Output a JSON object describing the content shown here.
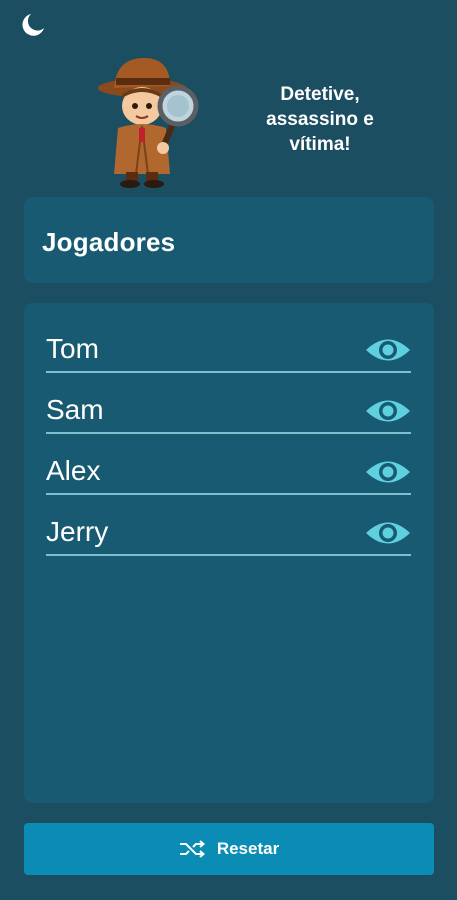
{
  "header": {
    "title": "Detetive,\nassassino e\nvítima!"
  },
  "players_card": {
    "title": "Jogadores"
  },
  "players": [
    {
      "name": "Tom"
    },
    {
      "name": "Sam"
    },
    {
      "name": "Alex"
    },
    {
      "name": "Jerry"
    }
  ],
  "footer": {
    "reset_label": "Resetar"
  },
  "icons": {
    "theme": "moon-icon",
    "reveal": "eye-icon",
    "reset": "shuffle-icon"
  },
  "colors": {
    "background": "#1c4e61",
    "card": "#185a72",
    "accent": "#5fd0e0",
    "button": "#0a8cb4"
  }
}
